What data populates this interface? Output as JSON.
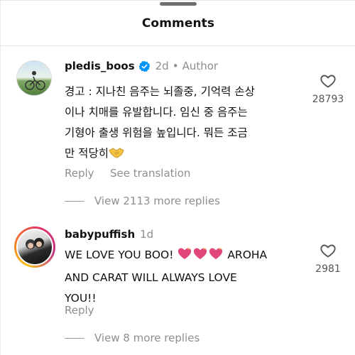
{
  "sheet": {
    "title": "Comments"
  },
  "comments": [
    {
      "username": "pledis_boos",
      "verified": true,
      "time": "2d",
      "author_label": "Author",
      "text_lines": [
        "경고 : 지나친 음주는 뇌졸중, 기억력 손상",
        "이나 치매를 유발합니다. 임신 중 음주는",
        "기형아 출생 위험을 높입니다. 뭐든 조금",
        "만 적당히"
      ],
      "reply_label": "Reply",
      "translate_label": "See translation",
      "likes": "28793",
      "view_replies": "View 2113 more replies"
    },
    {
      "username": "babypuffish",
      "time": "1d",
      "text_lines": [
        "WE LOVE YOU BOO!",
        "AROHA",
        "AND CARAT WILL ALWAYS LOVE",
        "YOU!!"
      ],
      "reply_label": "Reply",
      "likes": "2981",
      "view_replies": "View 8 more replies"
    }
  ],
  "icons": {
    "like": "heart-outline-icon",
    "verified": "verified-badge-icon",
    "handshake": "handshake-emoji",
    "sparkle_heart": "sparkling-heart-emoji"
  },
  "colors": {
    "verified_blue": "#0095f6",
    "muted_text": "#8e8e8e",
    "heart_emoji": "#e0457b"
  }
}
